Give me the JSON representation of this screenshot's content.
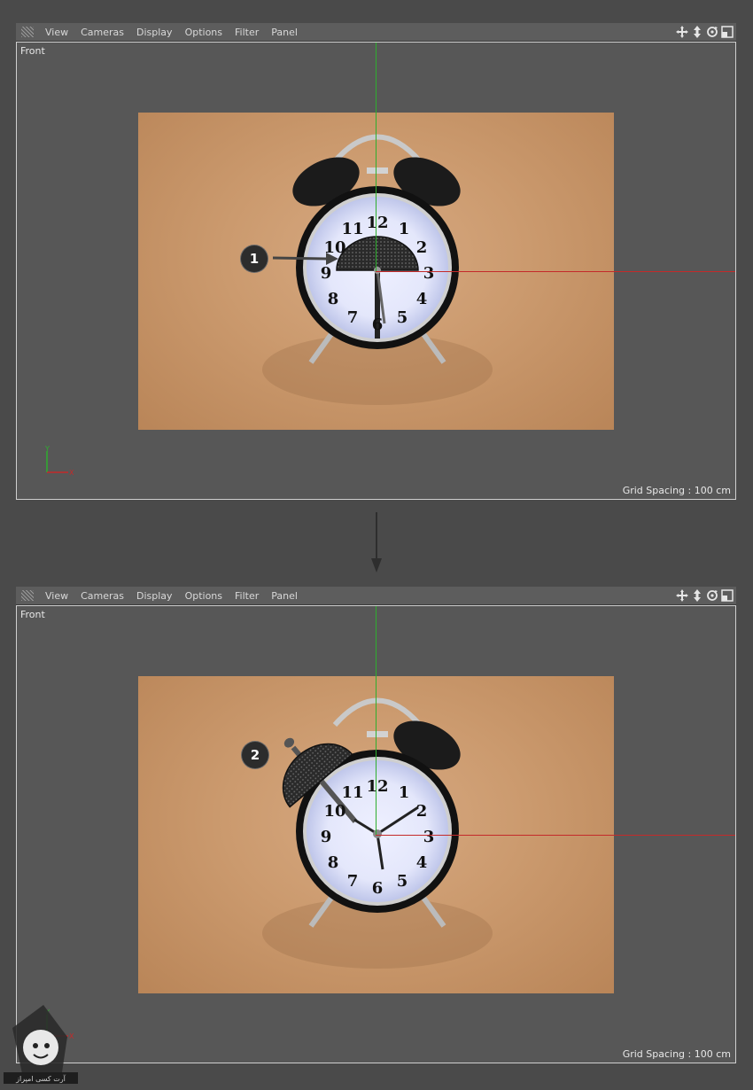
{
  "menu": [
    "View",
    "Cameras",
    "Display",
    "Options",
    "Filter",
    "Panel"
  ],
  "nav_icons": [
    "move-icon",
    "zoom-icon",
    "rotate-icon",
    "maximize-icon"
  ],
  "panels": [
    {
      "view_label": "Front",
      "grid_spacing": "Grid Spacing : 100 cm",
      "step_badge": "1"
    },
    {
      "view_label": "Front",
      "grid_spacing": "Grid Spacing : 100 cm",
      "step_badge": "2"
    }
  ],
  "axes": {
    "x": "X",
    "y": "Y"
  },
  "clock_numbers": [
    "12",
    "1",
    "2",
    "3",
    "4",
    "5",
    "6",
    "7",
    "8",
    "9",
    "10",
    "11"
  ],
  "watermark_text": "آرت کسی امپراز",
  "colors": {
    "background": "#4a4a4a",
    "viewport": "#575757",
    "menubar": "#5d5d5d",
    "y_axis": "#2fae2f",
    "x_axis": "#c42a2a",
    "paper": "#cb9a6e"
  }
}
